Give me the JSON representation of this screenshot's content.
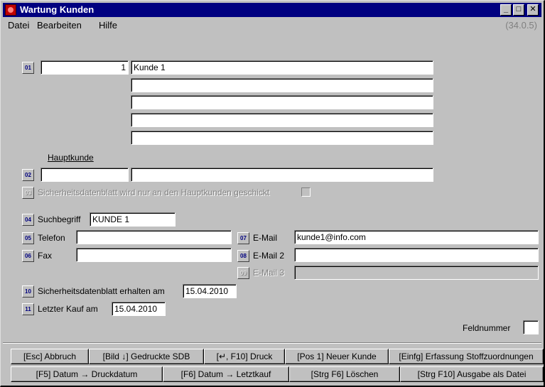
{
  "window": {
    "title": "Wartung Kunden",
    "minimize": "_",
    "maximize": "□",
    "close": "✕",
    "icon": "app-icon"
  },
  "menu": {
    "items": [
      {
        "label": "Datei"
      },
      {
        "label": "Bearbeiten"
      },
      {
        "label": "Hilfe"
      }
    ],
    "version": "(34.0.5)"
  },
  "form": {
    "f01": {
      "num": "01",
      "number": "1",
      "name_lines": [
        "Kunde 1",
        "",
        "",
        "",
        ""
      ]
    },
    "hauptkunde_label": "Hauptkunde",
    "f02": {
      "num": "02",
      "value_left": "",
      "value_right": ""
    },
    "f03": {
      "num": "03",
      "label": "Sicherheitsdatenblatt wird nur an den Hauptkunden geschickt",
      "checked": false
    },
    "f04": {
      "num": "04",
      "label": "Suchbegriff",
      "value": "KUNDE 1"
    },
    "f05": {
      "num": "05",
      "label": "Telefon",
      "value": ""
    },
    "f06": {
      "num": "06",
      "label": "Fax",
      "value": ""
    },
    "f07": {
      "num": "07",
      "label": "E-Mail",
      "value": "kunde1@info.com"
    },
    "f08": {
      "num": "08",
      "label": "E-Mail 2",
      "value": ""
    },
    "f09": {
      "num": "09",
      "label": "E-Mail 3",
      "value": ""
    },
    "f10": {
      "num": "10",
      "label": "Sicherheitsdatenblatt erhalten am",
      "value": "15.04.2010"
    },
    "f11": {
      "num": "11",
      "label": "Letzter Kauf am",
      "value": "15.04.2010"
    },
    "feldnummer": {
      "label": "Feldnummer",
      "value": ""
    }
  },
  "fkeys": {
    "row1": [
      "[Esc] Abbruch",
      "[Bild ↓] Gedruckte SDB",
      "[↵, F10] Druck",
      "[Pos 1] Neuer Kunde",
      "[Einfg] Erfassung Stoffzuordnungen"
    ],
    "row2": [
      "[F5] Datum → Druckdatum",
      "[F6] Datum → Letztkauf",
      "[Strg F6] Löschen",
      "[Strg F10] Ausgabe als Datei"
    ]
  }
}
